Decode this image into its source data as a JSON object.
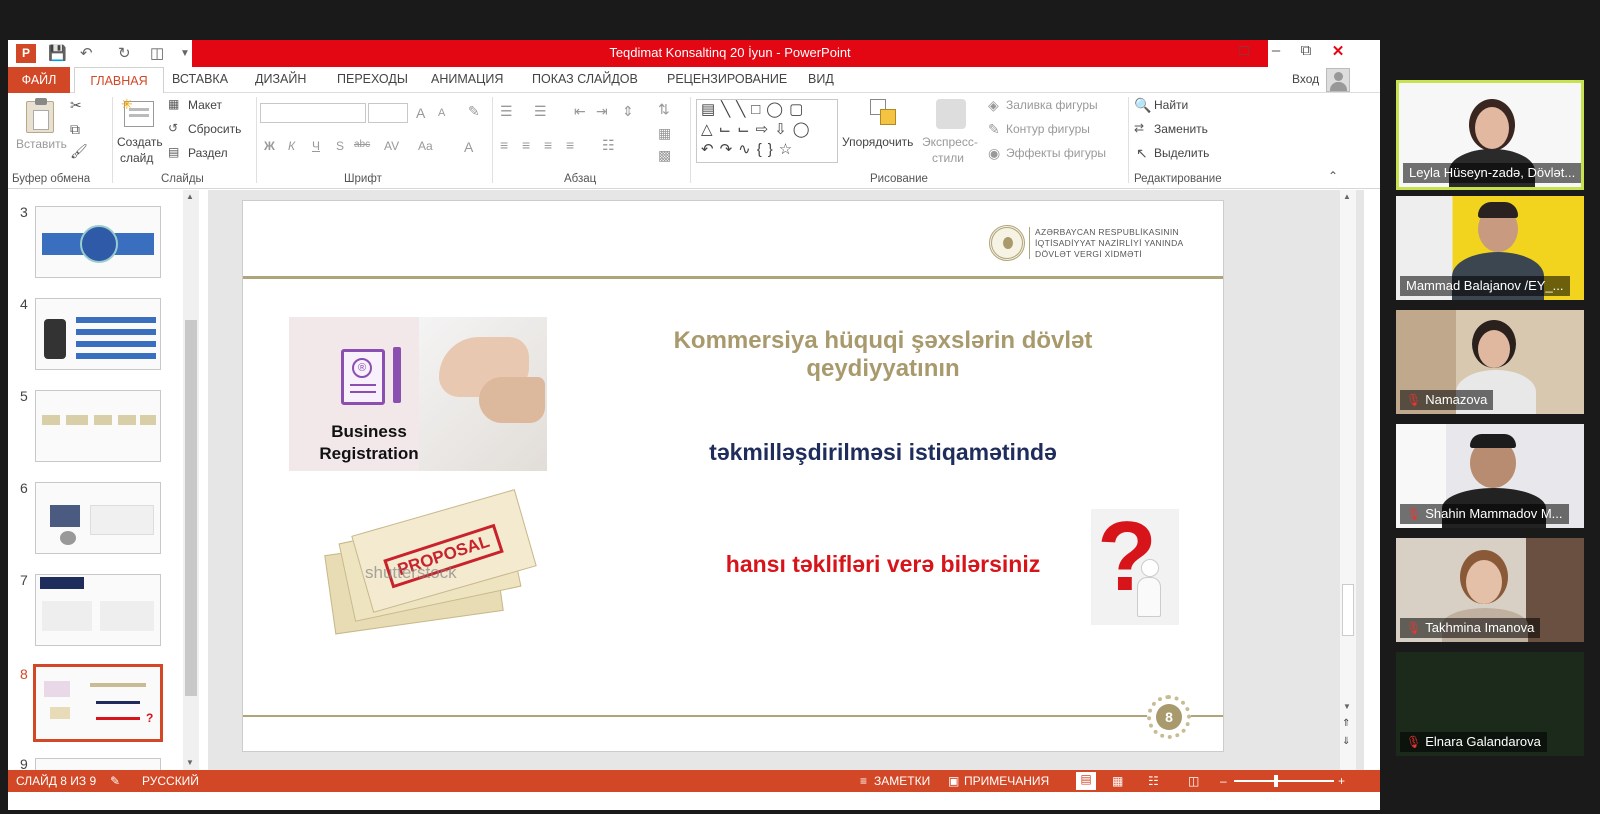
{
  "window": {
    "title": "Teqdimat Konsaltinq  20 İyun -  PowerPoint",
    "signin": "Вход"
  },
  "tabs": {
    "file": "ФАЙЛ",
    "home": "ГЛАВНАЯ",
    "insert": "ВСТАВКА",
    "design": "ДИЗАЙН",
    "transitions": "ПЕРЕХОДЫ",
    "animation": "АНИМАЦИЯ",
    "slideshow": "ПОКАЗ СЛАЙДОВ",
    "review": "РЕЦЕНЗИРОВАНИЕ",
    "view": "ВИД"
  },
  "ribbon": {
    "clipboard": {
      "paste": "Вставить",
      "label": "Буфер обмена"
    },
    "slides": {
      "new_slide_1": "Создать",
      "new_slide_2": "слайд",
      "layout": "Макет",
      "reset": "Сбросить",
      "section": "Раздел",
      "label": "Слайды"
    },
    "font": {
      "bold": "Ж",
      "italic": "К",
      "underline": "Ч",
      "shadow": "S",
      "strike": "abc",
      "spacing": "AV",
      "case": "Aa",
      "color": "A",
      "grow": "A",
      "shrink": "A",
      "label": "Шрифт"
    },
    "paragraph": {
      "label": "Абзац"
    },
    "drawing": {
      "arrange": "Упорядочить",
      "quick_styles_1": "Экспресс-",
      "quick_styles_2": "стили",
      "fill": "Заливка фигуры",
      "outline": "Контур фигуры",
      "effects": "Эффекты фигуры",
      "label": "Рисование"
    },
    "editing": {
      "find": "Найти",
      "replace": "Заменить",
      "select": "Выделить",
      "label": "Редактирование"
    }
  },
  "thumbnails": {
    "numbers": [
      "3",
      "4",
      "5",
      "6",
      "7",
      "8",
      "9"
    ],
    "selected": "8"
  },
  "slide": {
    "logo_lines": [
      "AZƏRBAYCAN RESPUBLİKASININ",
      "İQTİSADİYYAT NAZİRLİYİ YANINDA",
      "DÖVLƏT VERGİ XİDMƏTİ"
    ],
    "title_line1": "Kommersiya hüquqi şəxslərin dövlət",
    "title_line2": "qeydiyyatının",
    "subtitle": "təkmilləşdirilməsi istiqamətində",
    "question": "hansı təklifləri verə bilərsiniz",
    "business_line1": "Business",
    "business_line2": "Registration",
    "proposal_stamp": "PROPOSAL",
    "watermark": "shutterstock",
    "page_number": "8"
  },
  "status": {
    "slide_of": "СЛАЙД 8 ИЗ 9",
    "language": "РУССКИЙ",
    "notes": "ЗАМЕТКИ",
    "comments": "ПРИМЕЧАНИЯ"
  },
  "participants": [
    {
      "name": "Leyla Hüseyn-zadə, Dövlət...",
      "muted": false,
      "active": true
    },
    {
      "name": "Mammad Balajanov /EY_...",
      "muted": false,
      "active": false
    },
    {
      "name": "Namazova",
      "muted": true,
      "active": false
    },
    {
      "name": "Shahin Mammadov M...",
      "muted": true,
      "active": false
    },
    {
      "name": "Takhmina Imanova",
      "muted": true,
      "active": false
    },
    {
      "name": "Elnara Galandarova",
      "muted": true,
      "active": false
    }
  ],
  "colors": {
    "accent": "#d24726",
    "title_bar": "#e30613",
    "slide_title": "#a89a6c",
    "subtitle": "#1f2d5c",
    "question": "#d7141a",
    "active_speaker": "#c6e24f"
  }
}
